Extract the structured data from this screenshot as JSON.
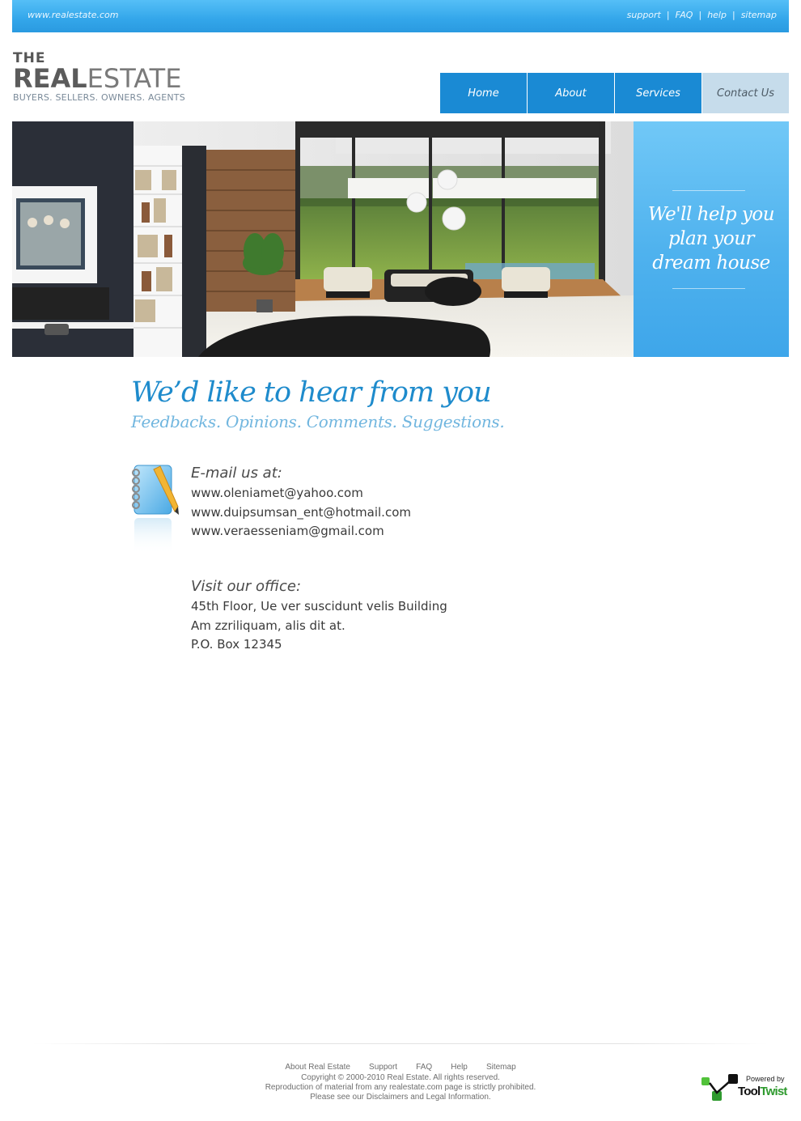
{
  "topbar": {
    "site_url": "www.realestate.com",
    "links": [
      "support",
      "FAQ",
      "help",
      "sitemap"
    ],
    "separator": "|"
  },
  "logo": {
    "the": "THE",
    "real": "REAL",
    "estate": "ESTATE",
    "tagline": "BUYERS. SELLERS. OWNERS. AGENTS"
  },
  "nav": {
    "items": [
      "Home",
      "About",
      "Services",
      "Contact Us"
    ],
    "active": "Contact Us"
  },
  "hero": {
    "tagline_line1": "We'll help you",
    "tagline_line2": "plan your",
    "tagline_line3": "dream house"
  },
  "contact": {
    "heading": "We’d like to hear from you",
    "subheading": "Feedbacks. Opinions. Comments. Suggestions.",
    "email_title": "E-mail us at:",
    "emails": [
      "www.oleniamet@yahoo.com",
      "www.duipsumsan_ent@hotmail.com",
      "www.veraesseniam@gmail.com"
    ],
    "office_title": "Visit our office:",
    "address": [
      "45th Floor, Ue ver suscidunt velis Building",
      "Am zzriliquam, alis dit at.",
      "P.O. Box 12345"
    ]
  },
  "footer": {
    "links": [
      "About Real Estate",
      "Support",
      "FAQ",
      "Help",
      "Sitemap"
    ],
    "copyright": [
      "Copyright © 2000-2010 Real Estate. All rights reserved.",
      "Reproduction of material from any realestate.com page is strictly prohibited.",
      "Please see our Disclaimers and Legal Information."
    ],
    "powered_by": "Powered by",
    "brand_tool": "Tool",
    "brand_twist": "Twist"
  },
  "colors": {
    "accent": "#1a8ad4",
    "nav_active_bg": "#c6dceb",
    "heading": "#1e8bcc",
    "subheading": "#71b6df"
  }
}
